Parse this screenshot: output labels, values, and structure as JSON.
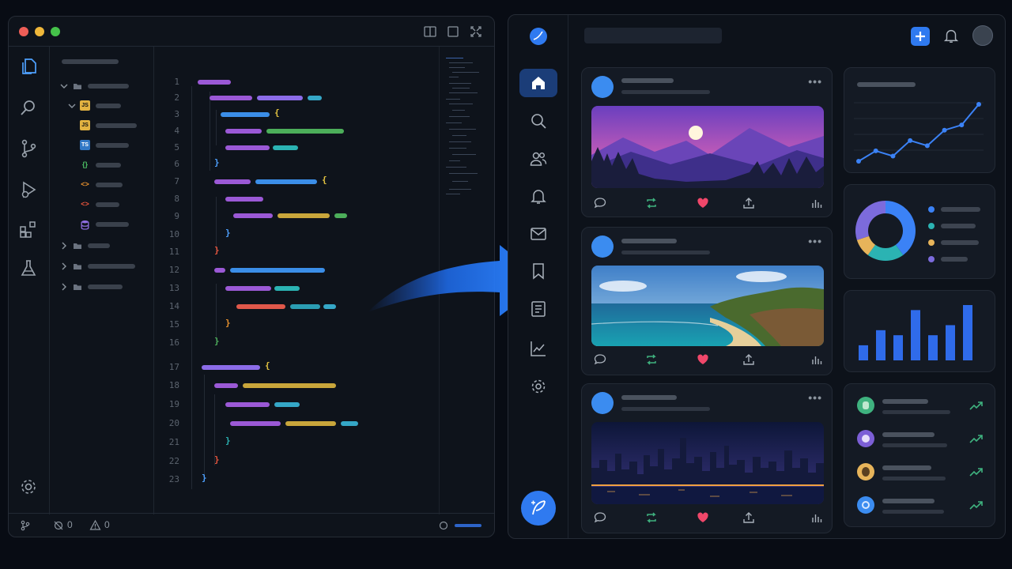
{
  "editor": {
    "line_numbers": [
      "1",
      "2",
      "3",
      "4",
      "5",
      "6",
      "7",
      "8",
      "9",
      "10",
      "11",
      "12",
      "13",
      "14",
      "15",
      "16",
      "17",
      "18",
      "19",
      "20",
      "21",
      "22",
      "23"
    ],
    "file_badges": [
      "JS",
      "JS",
      "TS",
      "{}",
      "<>",
      "<>"
    ],
    "brackets": {
      "open": "{",
      "close": "}"
    },
    "status": {
      "sync_count": "0",
      "warning_count": "0"
    },
    "activity_icons": [
      "files-icon",
      "search-icon",
      "source-control-icon",
      "run-debug-icon",
      "extensions-icon",
      "flask-icon",
      "settings-icon"
    ]
  },
  "feed": {
    "sidebar_icons": [
      "home-icon",
      "search-icon",
      "people-icon",
      "bell-icon",
      "mail-icon",
      "bookmark-icon",
      "document-icon",
      "chart-icon",
      "settings-icon"
    ],
    "compose_icon": "feather-icon",
    "more_glyph": "•••",
    "photos": [
      "mountain-sunset",
      "ocean-coast",
      "city-night"
    ],
    "line_chart": {
      "values": [
        2,
        4,
        3,
        6,
        5,
        8,
        9,
        13
      ]
    },
    "donut": {
      "values": [
        40,
        20,
        10,
        30
      ],
      "colors": [
        "#3b82f6",
        "#2bb3b3",
        "#e7b45a",
        "#7c6bdc"
      ]
    },
    "bar_chart": {
      "values": [
        3,
        6,
        5,
        10,
        5,
        7,
        11
      ]
    },
    "colors": {
      "accent": "#3b8cf0",
      "heart": "#f0476a",
      "retweet": "#3fb27f",
      "trend": "#3fb27f"
    }
  }
}
